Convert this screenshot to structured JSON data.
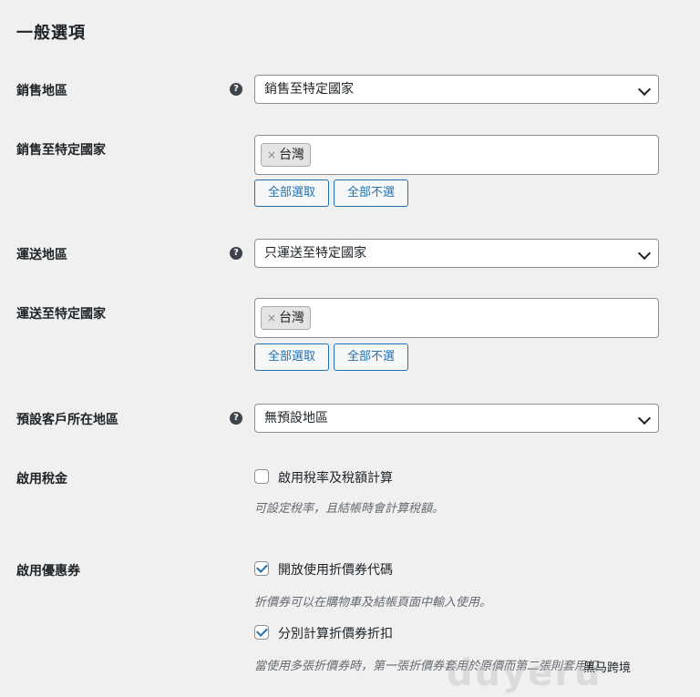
{
  "section_title": "一般選項",
  "rows": {
    "sell_region": {
      "label": "銷售地區",
      "value": "銷售至特定國家"
    },
    "sell_countries": {
      "label": "銷售至特定國家",
      "chip": "台灣"
    },
    "ship_region": {
      "label": "運送地區",
      "value": "只運送至特定國家"
    },
    "ship_countries": {
      "label": "運送至特定國家",
      "chip": "台灣"
    },
    "default_location": {
      "label": "預設客戶所在地區",
      "value": "無預設地區"
    },
    "enable_taxes": {
      "label": "啟用稅金",
      "checkbox_label": "啟用稅率及稅額計算",
      "checked": false,
      "description": "可設定稅率，且結帳時會計算稅額。"
    },
    "enable_coupons": {
      "label": "啟用優惠券",
      "checkbox1_label": "開放使用折價券代碼",
      "checkbox1_checked": true,
      "description1": "折價券可以在購物車及結帳頁面中輸入使用。",
      "checkbox2_label": "分別計算折價券折扣",
      "checkbox2_checked": true,
      "description2": "當使用多張折價券時，第一張折價券套用於原價而第二張則套用扣"
    }
  },
  "buttons": {
    "select_all": "全部選取",
    "select_none": "全部不選"
  },
  "chip_remove": "×",
  "help_icon_glyph": "?",
  "watermark": {
    "text": "duyeru",
    "caption": "黑马跨境"
  },
  "colors": {
    "accent": "#2271b1",
    "background": "#f0f0f1",
    "text": "#1d2327",
    "description": "#646970"
  }
}
